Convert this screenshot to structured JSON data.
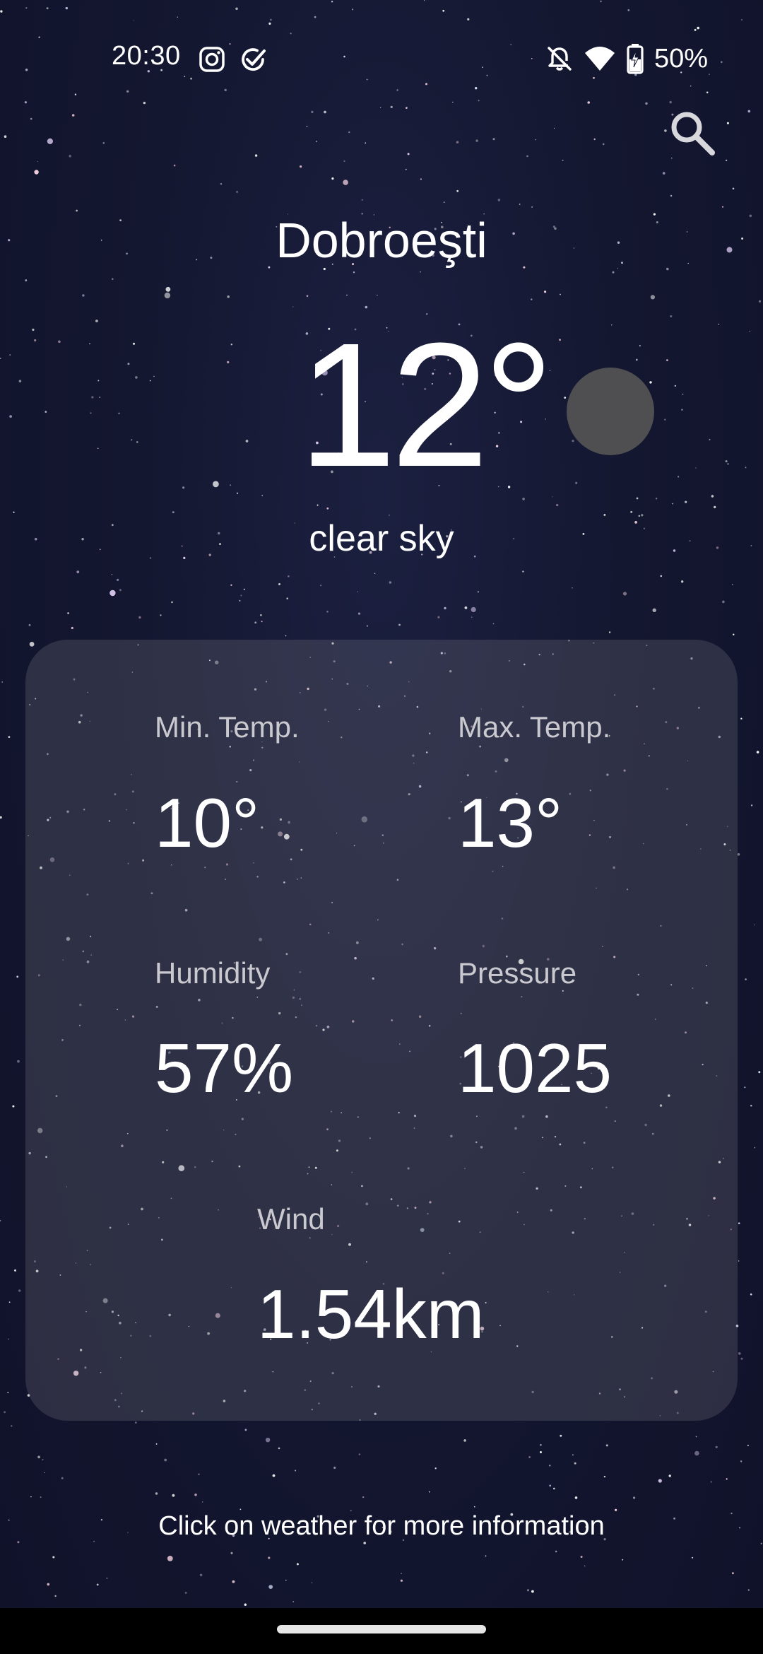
{
  "status_bar": {
    "time": "20:30",
    "battery_text": "50%",
    "icons_left": [
      "instagram-icon",
      "check-circle-icon"
    ],
    "icons_right": [
      "notifications-off-icon",
      "wifi-icon",
      "battery-charging-icon"
    ]
  },
  "header": {
    "search_icon": "search-icon"
  },
  "weather": {
    "city": "Dobroeşti",
    "temperature": "12°",
    "description": "clear sky",
    "icon": "moon-icon"
  },
  "stats": {
    "min_temp": {
      "label": "Min. Temp.",
      "value": "10°"
    },
    "max_temp": {
      "label": "Max. Temp.",
      "value": "13°"
    },
    "humidity": {
      "label": "Humidity",
      "value": "57%"
    },
    "pressure": {
      "label": "Pressure",
      "value": "1025"
    },
    "wind": {
      "label": "Wind",
      "value": "1.54km"
    }
  },
  "footer": {
    "hint": "Click on weather for more information"
  },
  "colors": {
    "background": "#141730",
    "card": "#3c3c46",
    "text": "#ffffff",
    "label": "#c9c9cf",
    "weather_icon": "#4f4f52"
  }
}
